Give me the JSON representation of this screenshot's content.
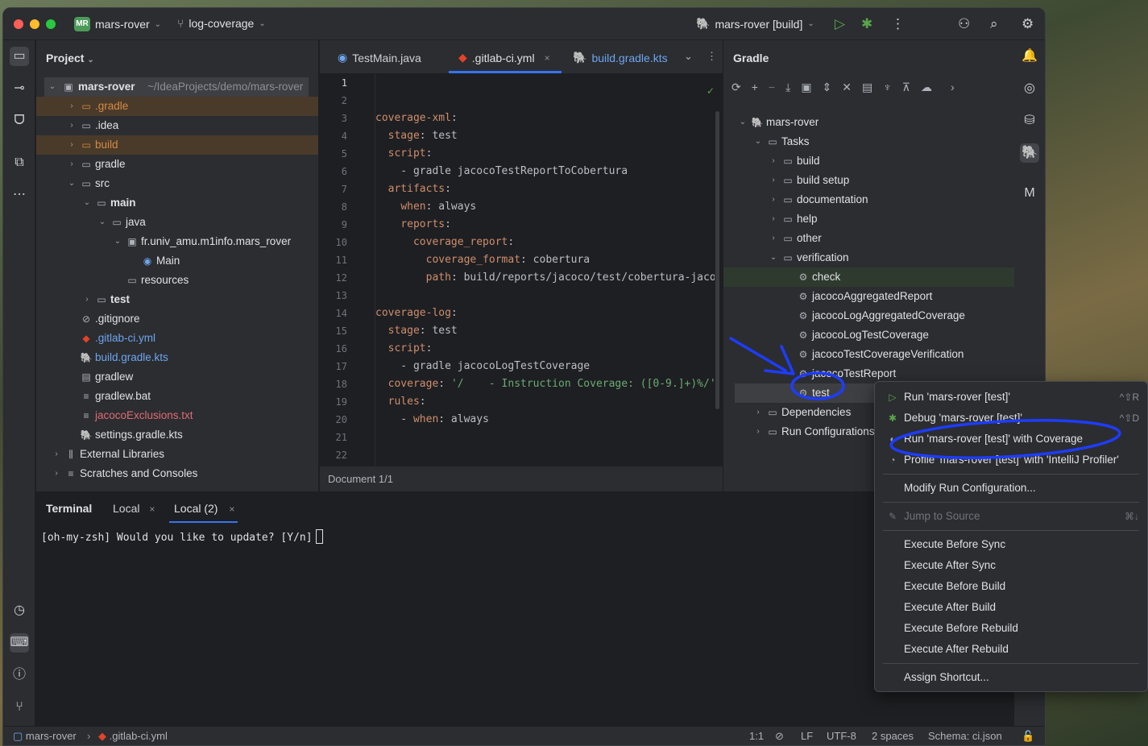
{
  "titlebar": {
    "project_badge": "MR",
    "project": "mars-rover",
    "branch": "log-coverage",
    "run_config": "mars-rover [build]"
  },
  "project_panel": {
    "title": "Project",
    "root_name": "mars-rover",
    "root_path": "~/IdeaProjects/demo/mars-rover",
    "items": [
      {
        "label": ".gradle"
      },
      {
        "label": ".idea"
      },
      {
        "label": "build"
      },
      {
        "label": "gradle"
      },
      {
        "label": "src"
      },
      {
        "label": "main"
      },
      {
        "label": "java"
      },
      {
        "label": "fr.univ_amu.m1info.mars_rover"
      },
      {
        "label": "Main"
      },
      {
        "label": "resources"
      },
      {
        "label": "test"
      },
      {
        "label": ".gitignore"
      },
      {
        "label": ".gitlab-ci.yml"
      },
      {
        "label": "build.gradle.kts"
      },
      {
        "label": "gradlew"
      },
      {
        "label": "gradlew.bat"
      },
      {
        "label": "jacocoExclusions.txt"
      },
      {
        "label": "settings.gradle.kts"
      },
      {
        "label": "External Libraries"
      },
      {
        "label": "Scratches and Consoles"
      }
    ]
  },
  "editor": {
    "tabs": [
      {
        "label": "TestMain.java"
      },
      {
        "label": ".gitlab-ci.yml"
      },
      {
        "label": "build.gradle.kts"
      }
    ],
    "line_numbers": [
      "1",
      "2",
      "3",
      "4",
      "5",
      "6",
      "7",
      "8",
      "9",
      "10",
      "11",
      "12",
      "13",
      "14",
      "15",
      "16",
      "17",
      "18",
      "19",
      "20",
      "21",
      "22"
    ],
    "status": "Document 1/1"
  },
  "gradle_panel": {
    "title": "Gradle",
    "tree": [
      {
        "label": "mars-rover"
      },
      {
        "label": "Tasks"
      },
      {
        "label": "build"
      },
      {
        "label": "build setup"
      },
      {
        "label": "documentation"
      },
      {
        "label": "help"
      },
      {
        "label": "other"
      },
      {
        "label": "verification"
      },
      {
        "label": "check"
      },
      {
        "label": "jacocoAggregatedReport"
      },
      {
        "label": "jacocoLogAggregatedCoverage"
      },
      {
        "label": "jacocoLogTestCoverage"
      },
      {
        "label": "jacocoTestCoverageVerification"
      },
      {
        "label": "jacocoTestReport"
      },
      {
        "label": "test"
      },
      {
        "label": "Dependencies"
      },
      {
        "label": "Run Configurations"
      }
    ]
  },
  "context_menu": {
    "items": [
      {
        "label": "Run 'mars-rover [test]'",
        "shortcut": "^⇧R"
      },
      {
        "label": "Debug 'mars-rover [test]'",
        "shortcut": "^⇧D"
      },
      {
        "label": "Run 'mars-rover [test]' with Coverage",
        "shortcut": ""
      },
      {
        "label": "Profile 'mars-rover [test]' with 'IntelliJ Profiler'",
        "shortcut": ""
      },
      {
        "label": "Modify Run Configuration...",
        "shortcut": ""
      },
      {
        "label": "Jump to Source",
        "shortcut": "⌘↓"
      },
      {
        "label": "Execute Before Sync",
        "shortcut": ""
      },
      {
        "label": "Execute After Sync",
        "shortcut": ""
      },
      {
        "label": "Execute Before Build",
        "shortcut": ""
      },
      {
        "label": "Execute After Build",
        "shortcut": ""
      },
      {
        "label": "Execute Before Rebuild",
        "shortcut": ""
      },
      {
        "label": "Execute After Rebuild",
        "shortcut": ""
      },
      {
        "label": "Assign Shortcut...",
        "shortcut": ""
      }
    ]
  },
  "terminal": {
    "title": "Terminal",
    "tabs": [
      {
        "label": "Local"
      },
      {
        "label": "Local (2)"
      }
    ],
    "prompt": "[oh-my-zsh] Would you like to update? [Y/n]"
  },
  "statusbar": {
    "project": "mars-rover",
    "file": ".gitlab-ci.yml",
    "position": "1:1",
    "line_ending": "LF",
    "encoding": "UTF-8",
    "indent": "2 spaces",
    "schema": "Schema: ci.json"
  },
  "colors": {
    "accent": "#3574f0",
    "annotation": "#1e3cff",
    "ide_bg": "#1e1f22"
  }
}
